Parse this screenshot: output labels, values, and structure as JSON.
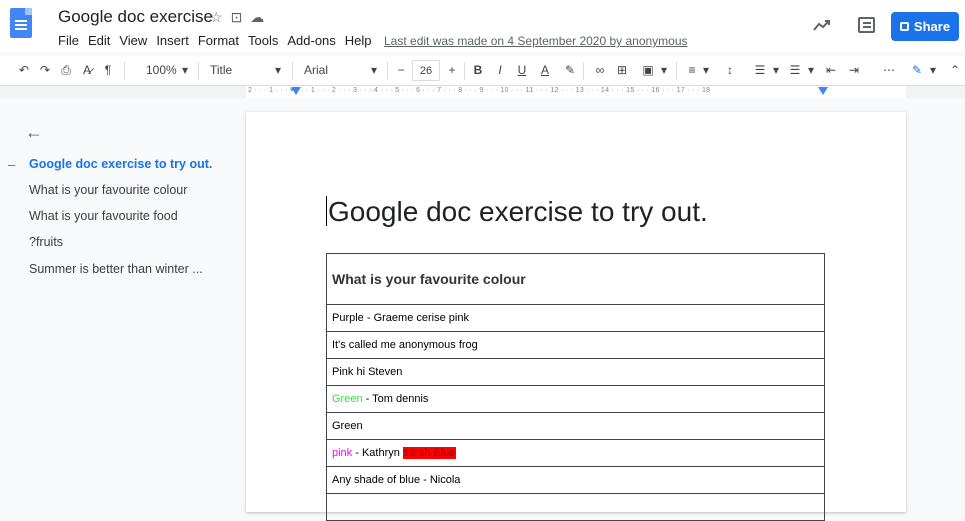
{
  "header": {
    "title": "Google doc exercise",
    "menu": [
      "File",
      "Edit",
      "View",
      "Insert",
      "Format",
      "Tools",
      "Add-ons",
      "Help"
    ],
    "last_edit": "Last edit was made on 4 September 2020 by anonymous",
    "share_label": "Share"
  },
  "toolbar": {
    "zoom": "100%",
    "style": "Title",
    "font": "Arial",
    "font_size": "26",
    "minus": "−",
    "plus": "+",
    "bold": "B",
    "italic": "I",
    "underline": "U",
    "text_color": "A"
  },
  "ruler": {
    "marks": "2 · · · 1 · · · ▾ · · · 1 · · · 2 · · · 3 · · · 4 · · · 5 · · · 6 · · · 7 · · · 8 · · · 9 · · · 10 · · · 11 · · · 12 · · · 13 · · · 14 · · · 15 · · · 16 · · · 17 · · · 18"
  },
  "outline": {
    "items": [
      "Google doc exercise to try out.",
      "What is your favourite colour",
      "What is your favourite food",
      "?fruits",
      "Summer is better than winter ..."
    ]
  },
  "document": {
    "heading": "Google doc exercise to try out.",
    "table_header": "What is your favourite colour",
    "rows": {
      "r1": "Purple - Graeme  cerise pink",
      "r2": "It's called me anonymous frog",
      "r3": "Pink hi Steven",
      "r4_color": "Green",
      "r4_rest": " - Tom dennis",
      "r5": "Green",
      "r6_color": "pink",
      "r6_mid": " - Kathryn ",
      "r6_highlight": "sarah Blue",
      "r7": "Any shade of blue - Nicola"
    }
  },
  "colors": {
    "accent": "#1a73e8",
    "doc_blue": "#4285f4"
  }
}
